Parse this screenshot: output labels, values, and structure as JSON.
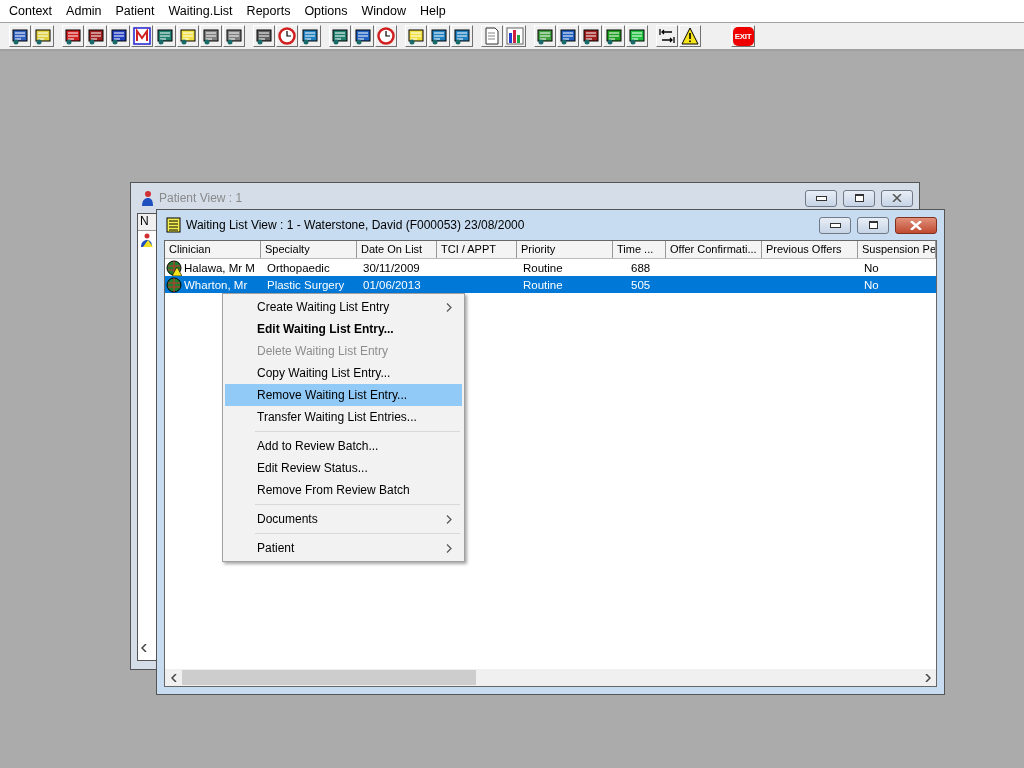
{
  "menubar": [
    {
      "label": "Context"
    },
    {
      "label": "Admin"
    },
    {
      "label": "Patient"
    },
    {
      "label": "Waiting.List"
    },
    {
      "label": "Reports"
    },
    {
      "label": "Options"
    },
    {
      "label": "Window"
    },
    {
      "label": "Help"
    }
  ],
  "toolbar": {
    "exit_label": "EXIT"
  },
  "patient_window": {
    "title": "Patient View : 1",
    "column": "N"
  },
  "waiting_window": {
    "title": "Waiting List View :  1 - Waterstone, David (F000053) 23/08/2000",
    "columns": [
      "Clinician",
      "Specialty",
      "Date On List",
      "TCI / APPT",
      "Priority",
      "Time ...",
      "Offer Confirmati...",
      "Previous Offers",
      "Suspension Pe"
    ],
    "rows": [
      {
        "selected": false,
        "warning": true,
        "cells": [
          "Halawa, Mr M",
          "Orthopaedic",
          "30/11/2009",
          "",
          "Routine",
          "688",
          "",
          "",
          "No"
        ]
      },
      {
        "selected": true,
        "warning": false,
        "cells": [
          "Wharton, Mr",
          "Plastic Surgery",
          "01/06/2013",
          "",
          "Routine",
          "505",
          "",
          "",
          "No"
        ]
      }
    ]
  },
  "context_menu": [
    {
      "kind": "item",
      "label": "Create Waiting List Entry",
      "submenu": true,
      "bold": false,
      "disabled": false,
      "selected": false
    },
    {
      "kind": "item",
      "label": "Edit Waiting List Entry...",
      "submenu": false,
      "bold": true,
      "disabled": false,
      "selected": false
    },
    {
      "kind": "item",
      "label": "Delete Waiting List Entry",
      "submenu": false,
      "bold": false,
      "disabled": true,
      "selected": false
    },
    {
      "kind": "item",
      "label": "Copy Waiting List Entry...",
      "submenu": false,
      "bold": false,
      "disabled": false,
      "selected": false
    },
    {
      "kind": "item",
      "label": "Remove Waiting List Entry...",
      "submenu": false,
      "bold": false,
      "disabled": false,
      "selected": true
    },
    {
      "kind": "item",
      "label": "Transfer Waiting List Entries...",
      "submenu": false,
      "bold": false,
      "disabled": false,
      "selected": false
    },
    {
      "kind": "separator"
    },
    {
      "kind": "item",
      "label": "Add to Review Batch...",
      "submenu": false,
      "bold": false,
      "disabled": false,
      "selected": false
    },
    {
      "kind": "item",
      "label": "Edit Review Status...",
      "submenu": false,
      "bold": false,
      "disabled": false,
      "selected": false
    },
    {
      "kind": "item",
      "label": "Remove From Review Batch",
      "submenu": false,
      "bold": false,
      "disabled": false,
      "selected": false
    },
    {
      "kind": "separator"
    },
    {
      "kind": "item",
      "label": "Documents",
      "submenu": true,
      "bold": false,
      "disabled": false,
      "selected": false
    },
    {
      "kind": "separator"
    },
    {
      "kind": "item",
      "label": "Patient",
      "submenu": true,
      "bold": false,
      "disabled": false,
      "selected": false
    }
  ]
}
